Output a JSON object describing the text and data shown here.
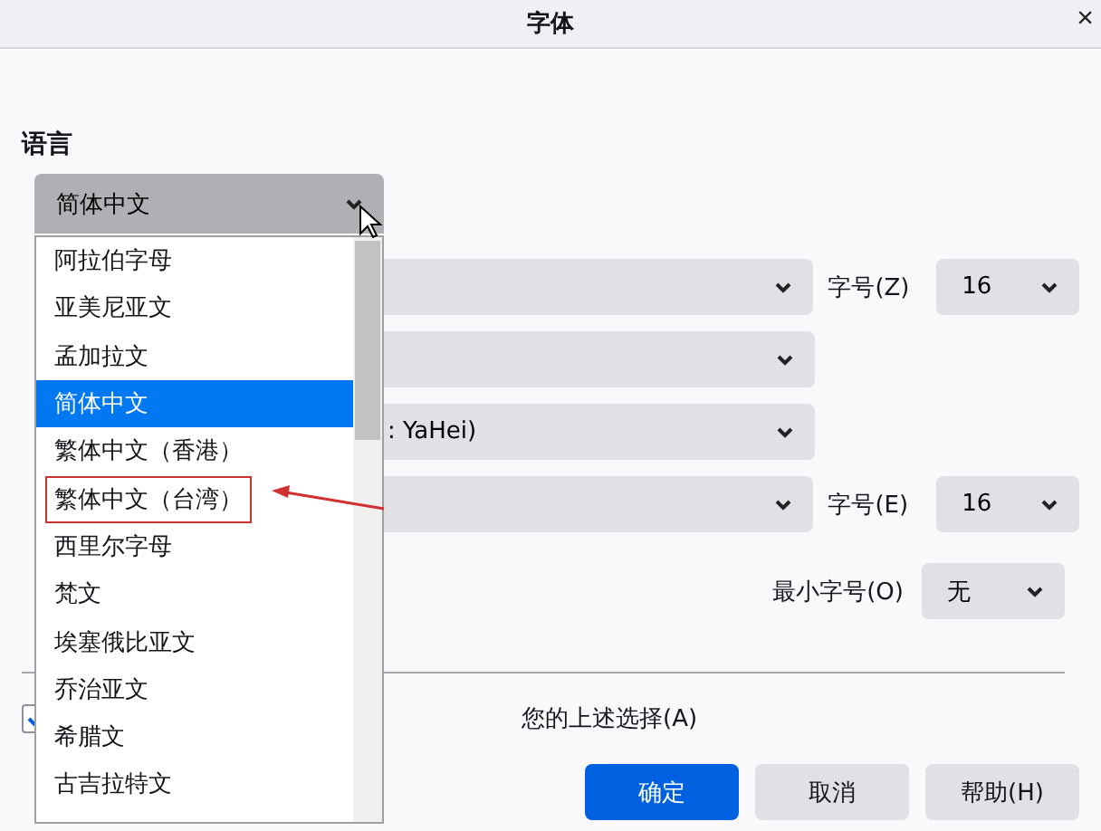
{
  "window": {
    "title": "字体",
    "close": "×"
  },
  "section_title": "语言",
  "language_select": {
    "value": "简体中文",
    "open": true
  },
  "font_rows": [
    {
      "label": "",
      "value": "",
      "size_label": "字号(Z)",
      "size": "16"
    },
    {
      "label": "",
      "value": "",
      "size_label": "",
      "size": ""
    },
    {
      "label": "",
      "value": ": YaHei)",
      "size_label": "",
      "size": ""
    },
    {
      "label": "",
      "value": "",
      "size_label": "字号(E)",
      "size": "16"
    }
  ],
  "min_size": {
    "label": "最小字号(O)",
    "value": "无"
  },
  "allow_override": {
    "checked": true,
    "label": "您的上述选择(A)"
  },
  "buttons": [
    {
      "label": "确定",
      "primary": true
    },
    {
      "label": "取消",
      "primary": false
    },
    {
      "label": "帮助(H)",
      "primary": false
    }
  ],
  "dropdown_items": [
    {
      "label": "阿拉伯字母",
      "selected": false,
      "annotated": false
    },
    {
      "label": "亚美尼亚文",
      "selected": false,
      "annotated": false
    },
    {
      "label": "孟加拉文",
      "selected": false,
      "annotated": false
    },
    {
      "label": "简体中文",
      "selected": true,
      "annotated": false
    },
    {
      "label": "繁体中文（香港）",
      "selected": false,
      "annotated": false
    },
    {
      "label": "繁体中文（台湾）",
      "selected": false,
      "annotated": true
    },
    {
      "label": "西里尔字母",
      "selected": false,
      "annotated": false
    },
    {
      "label": "梵文",
      "selected": false,
      "annotated": false
    },
    {
      "label": "埃塞俄比亚文",
      "selected": false,
      "annotated": false
    },
    {
      "label": "乔治亚文",
      "selected": false,
      "annotated": false
    },
    {
      "label": "希腊文",
      "selected": false,
      "annotated": false
    },
    {
      "label": "古吉拉特文",
      "selected": false,
      "annotated": false
    }
  ]
}
